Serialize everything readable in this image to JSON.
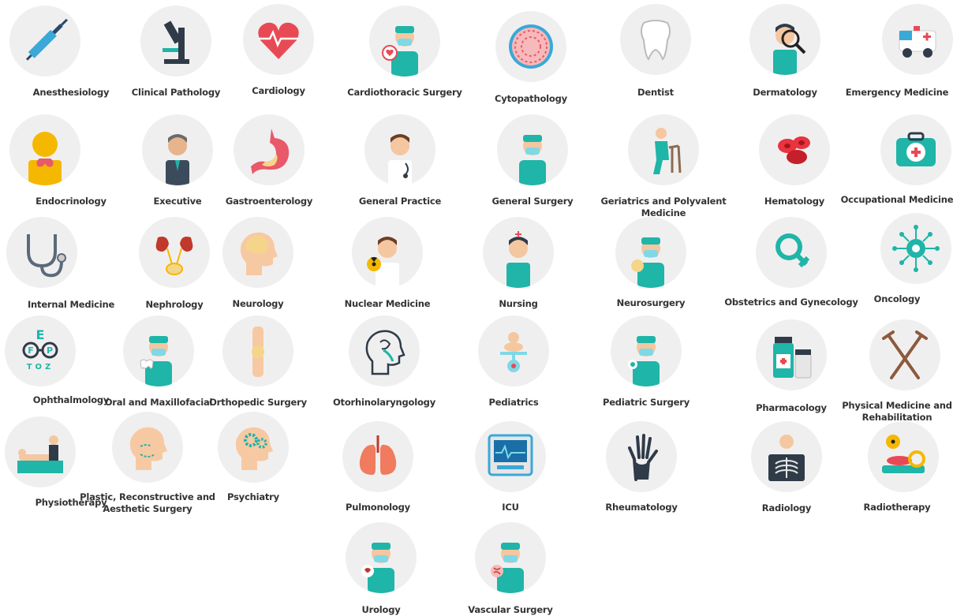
{
  "accent": "#1fb5a8",
  "specialties": [
    {
      "label": "Anesthesiology",
      "icon": "syringe-icon"
    },
    {
      "label": "Clinical Pathology",
      "icon": "microscope-icon"
    },
    {
      "label": "Cardiology",
      "icon": "heart-icon"
    },
    {
      "label": "Cardiothoracic Surgery",
      "icon": "surgeon-heart-icon"
    },
    {
      "label": "Cytopathology",
      "icon": "cell-icon"
    },
    {
      "label": "Dentist",
      "icon": "tooth-icon"
    },
    {
      "label": "Dermatology",
      "icon": "skin-magnifier-icon"
    },
    {
      "label": "Emergency Medicine",
      "icon": "ambulance-icon"
    },
    {
      "label": "Endocrinology",
      "icon": "thyroid-icon"
    },
    {
      "label": "Executive",
      "icon": "businessman-icon"
    },
    {
      "label": "Gastroenterology",
      "icon": "stomach-icon"
    },
    {
      "label": "General Practice",
      "icon": "doctor-icon"
    },
    {
      "label": "General Surgery",
      "icon": "surgeon-icon"
    },
    {
      "label": "Geriatrics and Polyvalent Medicine",
      "icon": "elderly-walker-icon"
    },
    {
      "label": "Hematology",
      "icon": "blood-cells-icon"
    },
    {
      "label": "Occupational Medicine",
      "icon": "first-aid-kit-icon"
    },
    {
      "label": "Internal Medicine",
      "icon": "stethoscope-icon"
    },
    {
      "label": "Nephrology",
      "icon": "kidneys-icon"
    },
    {
      "label": "Neurology",
      "icon": "head-brain-icon"
    },
    {
      "label": "Nuclear Medicine",
      "icon": "doctor-radiation-icon"
    },
    {
      "label": "Nursing",
      "icon": "nurse-icon"
    },
    {
      "label": "Neurosurgery",
      "icon": "surgeon-brain-icon"
    },
    {
      "label": "Obstetrics and Gynecology",
      "icon": "female-symbol-icon"
    },
    {
      "label": "Oncology",
      "icon": "cancer-cell-icon"
    },
    {
      "label": "Ophthalmology",
      "icon": "eye-chart-icon"
    },
    {
      "label": "Oral and Maxillofacial",
      "icon": "surgeon-teeth-icon"
    },
    {
      "label": "Orthopedic Surgery",
      "icon": "knee-joint-icon"
    },
    {
      "label": "Otorhinolaryngology",
      "icon": "ent-head-icon"
    },
    {
      "label": "Pediatrics",
      "icon": "baby-scale-icon"
    },
    {
      "label": "Pediatric Surgery",
      "icon": "surgeon-baby-icon"
    },
    {
      "label": "Pharmacology",
      "icon": "medicine-bottles-icon"
    },
    {
      "label": "Physical Medicine and Rehabilitation",
      "icon": "crutches-icon"
    },
    {
      "label": "Physiotherapy",
      "icon": "massage-table-icon"
    },
    {
      "label": "Plastic, Reconstructive and Aesthetic Surgery",
      "icon": "face-marking-icon"
    },
    {
      "label": "Psychiatry",
      "icon": "head-gears-icon"
    },
    {
      "label": "Pulmonology",
      "icon": "lungs-icon"
    },
    {
      "label": "ICU",
      "icon": "patient-monitor-icon"
    },
    {
      "label": "Rheumatology",
      "icon": "hand-xray-icon"
    },
    {
      "label": "Radiology",
      "icon": "chest-xray-icon"
    },
    {
      "label": "Radiotherapy",
      "icon": "radiation-bed-icon"
    },
    {
      "label": "Urology",
      "icon": "surgeon-bladder-icon"
    },
    {
      "label": "Vascular Surgery",
      "icon": "surgeon-vessels-icon"
    }
  ]
}
